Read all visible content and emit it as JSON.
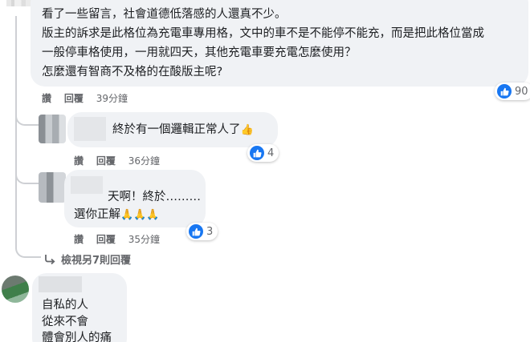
{
  "comment1": {
    "lines": [
      "看了一些留言，社會道德低落感的人還真不少。",
      "版主的訴求是此格位為充電車專用格，文中的車不是不能停不能充，而是把此格位當成",
      "一般停車格使用，一用就四天，其他充電車要充電怎麼使用？",
      "怎麼還有智商不及格的在酸版主呢?"
    ],
    "actions": {
      "like": "讚",
      "reply": "回覆",
      "time": "39分鐘"
    },
    "reaction_count": "90"
  },
  "reply1": {
    "text": "終於有一個邏輯正常人了",
    "emoji": "thumbs-up-emoji",
    "actions": {
      "like": "讚",
      "reply": "回覆",
      "time": "36分鐘"
    },
    "reaction_count": "4"
  },
  "reply2": {
    "line1": "天啊！終於………",
    "line2": "選你正解",
    "emoji": "praying-hands-emoji",
    "actions": {
      "like": "讚",
      "reply": "回覆",
      "time": "35分鐘"
    },
    "reaction_count": "3"
  },
  "more_replies": {
    "label": "檢視另7則回覆",
    "icon": "reply-arrow-icon"
  },
  "comment2": {
    "lines": [
      "自私的人",
      "從來不會",
      "體會別人的痛"
    ]
  },
  "colors": {
    "like_blue": "#1877f2",
    "bubble": "#f0f2f5",
    "meta": "#65676b"
  }
}
